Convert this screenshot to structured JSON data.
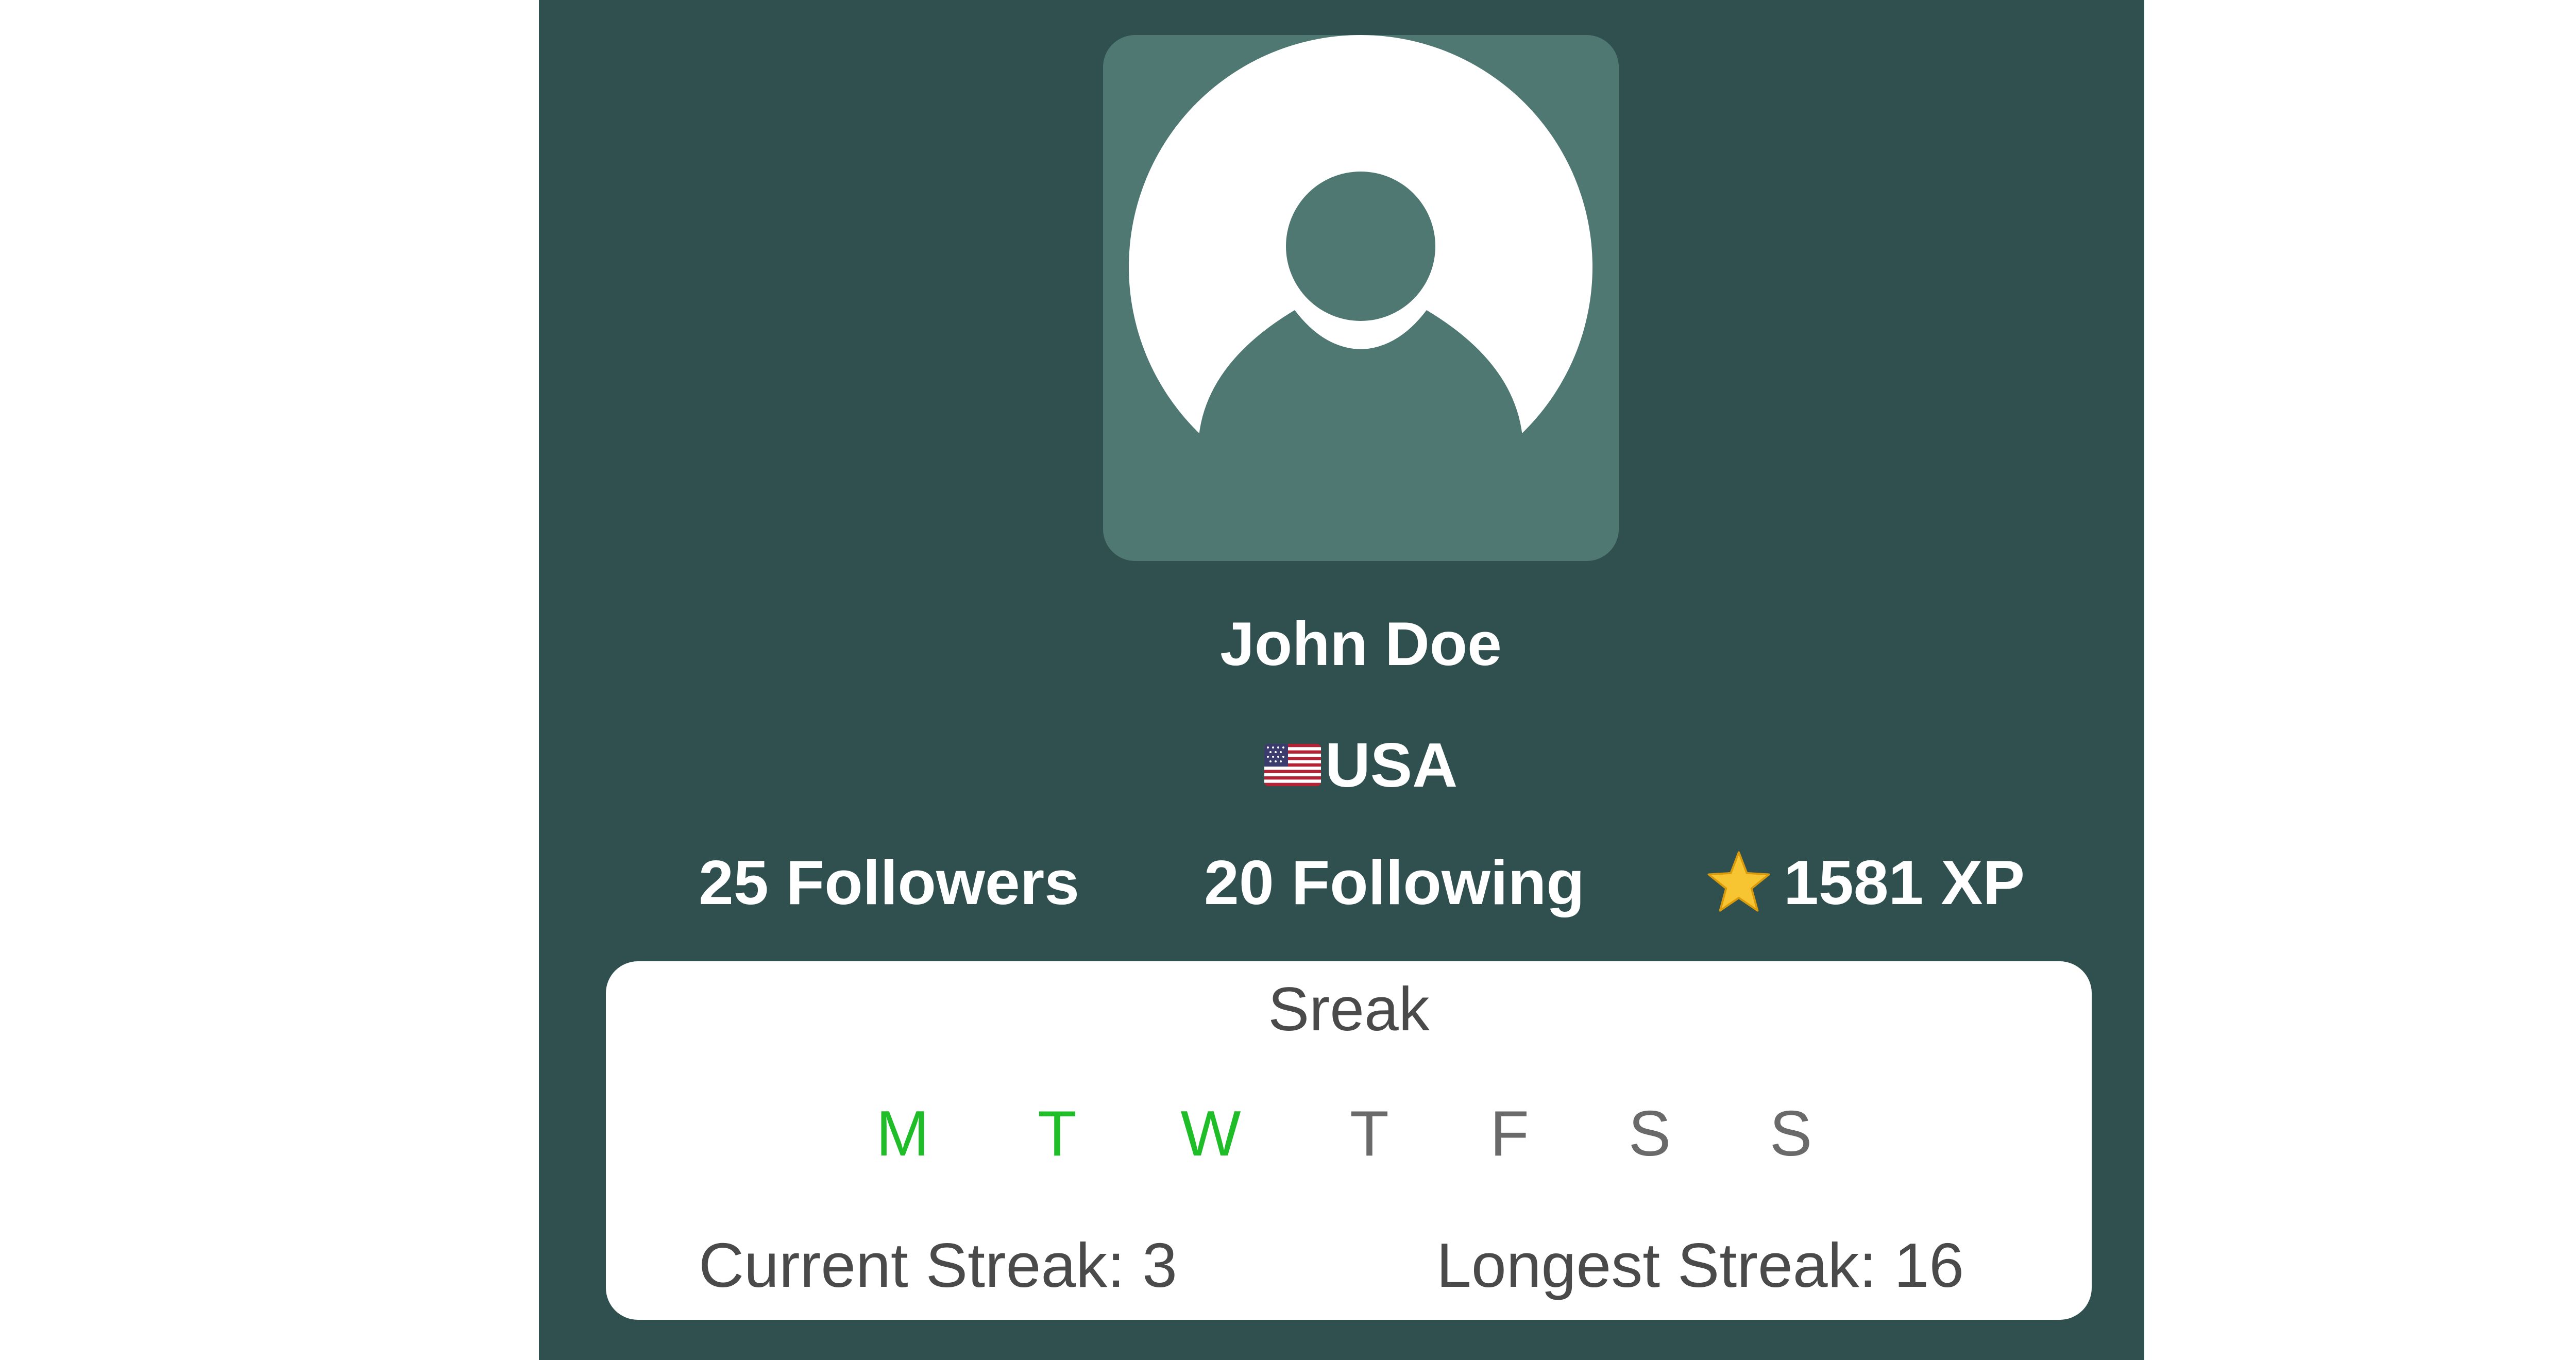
{
  "profile": {
    "name": "John Doe",
    "country": "USA",
    "flag_icon": "us-flag-icon"
  },
  "stats": {
    "followers": "25 Followers",
    "following": "20 Following",
    "xp": "1581 XP",
    "xp_icon": "star-icon"
  },
  "streak": {
    "title": "Sreak",
    "days": [
      {
        "label": "M",
        "done": true
      },
      {
        "label": "T",
        "done": true
      },
      {
        "label": "W",
        "done": true
      },
      {
        "label": "T",
        "done": false
      },
      {
        "label": "F",
        "done": false
      },
      {
        "label": "S",
        "done": false
      },
      {
        "label": "S",
        "done": false
      }
    ],
    "current": "Current Streak: 3",
    "longest": "Longest Streak: 16"
  },
  "colors": {
    "panel_bg": "#30504f",
    "avatar_bg": "#507873",
    "done_day": "#1fbe29",
    "pending_day": "#6a6a6a"
  }
}
